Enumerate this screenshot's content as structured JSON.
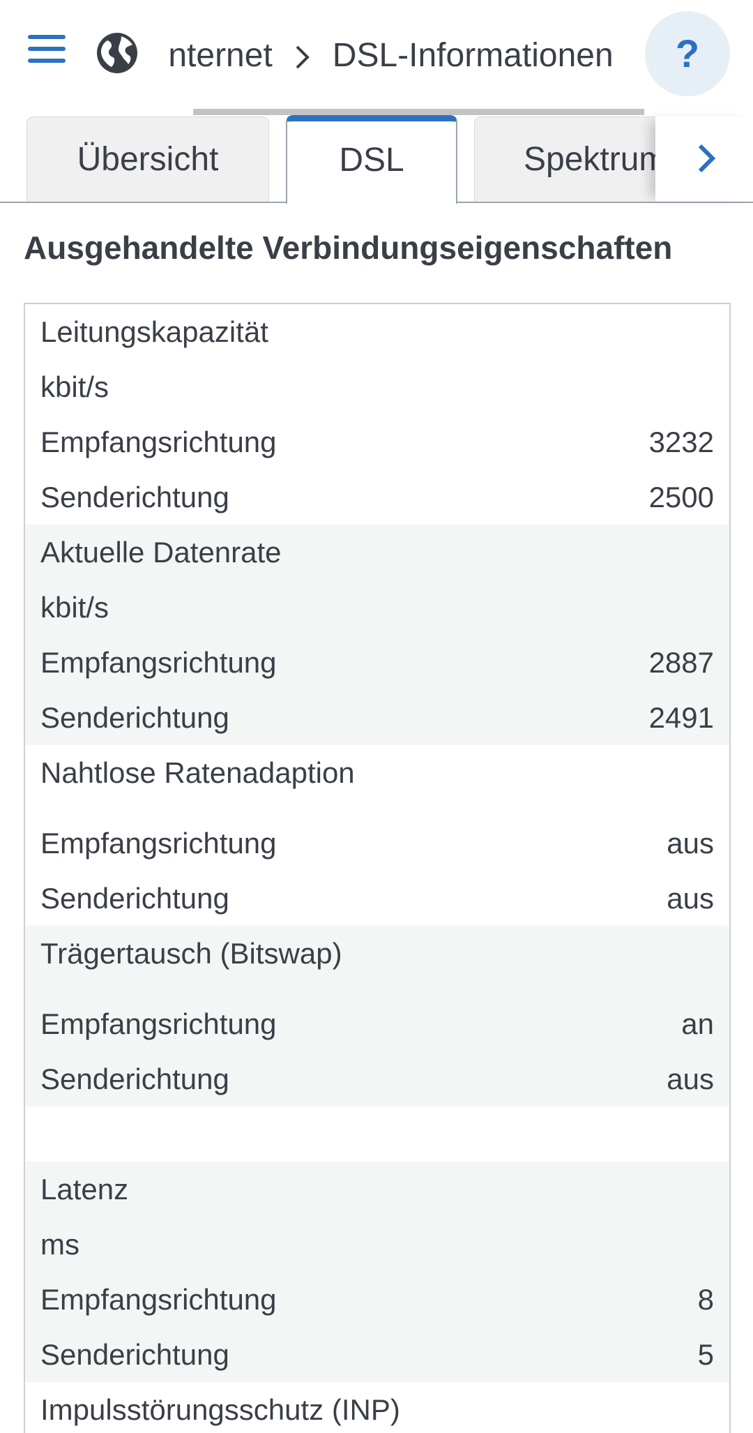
{
  "header": {
    "breadcrumb_parent": "Internet",
    "breadcrumb_current": "DSL-Informationen",
    "help_label": "?"
  },
  "tabs": [
    {
      "label": "Übersicht"
    },
    {
      "label": "DSL",
      "active": true
    },
    {
      "label": "Spektrum"
    }
  ],
  "section": {
    "title": "Ausgehandelte Verbindungseigenschaften"
  },
  "groups": [
    {
      "title": "Leitungskapazität",
      "unit": "kbit/s",
      "rows": [
        {
          "label": "Empfangsrichtung",
          "value": "3232"
        },
        {
          "label": "Senderichtung",
          "value": "2500"
        }
      ]
    },
    {
      "title": "Aktuelle Datenrate",
      "unit": "kbit/s",
      "rows": [
        {
          "label": "Empfangsrichtung",
          "value": "2887"
        },
        {
          "label": "Senderichtung",
          "value": "2491"
        }
      ]
    },
    {
      "title": "Nahtlose Ratenadaption",
      "rows": [
        {
          "label": "Empfangsrichtung",
          "value": "aus"
        },
        {
          "label": "Senderichtung",
          "value": "aus"
        }
      ]
    },
    {
      "title": "Trägertausch (Bitswap)",
      "rows": [
        {
          "label": "Empfangsrichtung",
          "value": "an"
        },
        {
          "label": "Senderichtung",
          "value": "aus"
        }
      ]
    },
    {
      "title": "Latenz",
      "unit": "ms",
      "rows": [
        {
          "label": "Empfangsrichtung",
          "value": "8"
        },
        {
          "label": "Senderichtung",
          "value": "5"
        }
      ]
    },
    {
      "title": "Impulsstörungsschutz (INP)"
    }
  ],
  "colors": {
    "accent": "#2a72c0",
    "text": "#3a3f47",
    "shaded_row": "#f4f5f5",
    "help_bg": "#e6eef6"
  }
}
